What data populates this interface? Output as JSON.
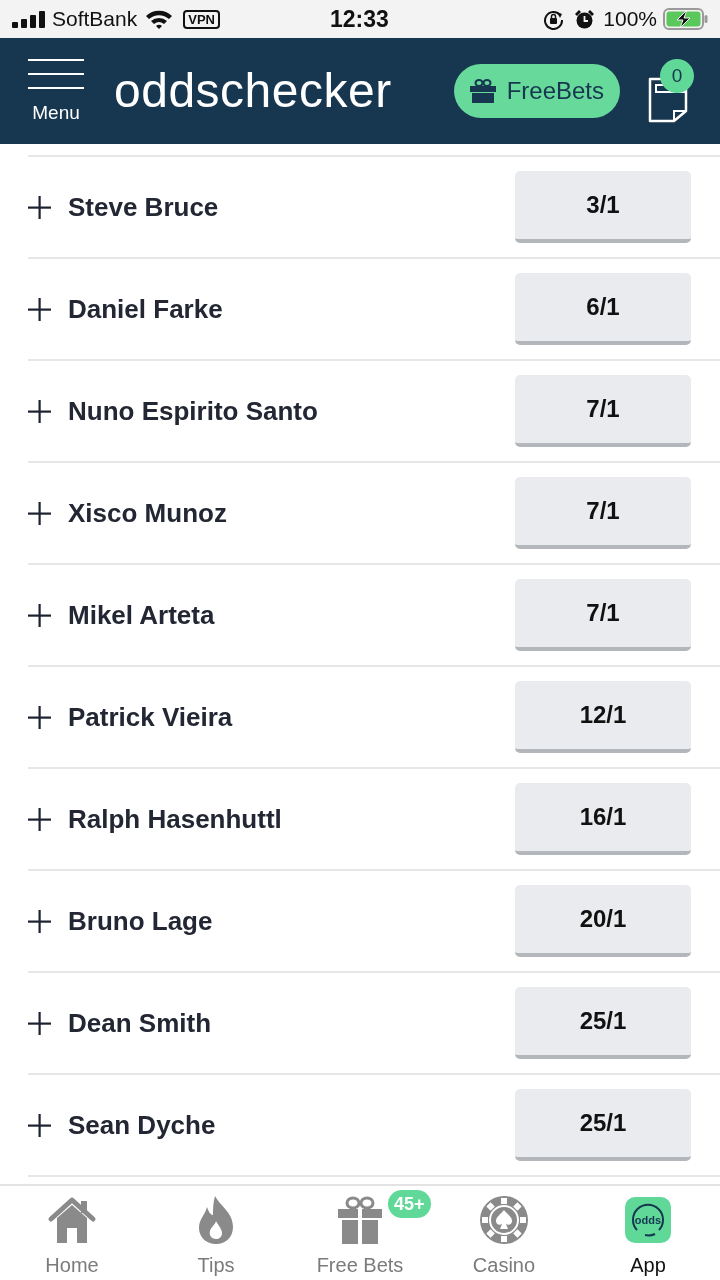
{
  "status_bar": {
    "carrier": "SoftBank",
    "vpn": "VPN",
    "time": "12:33",
    "battery": "100%"
  },
  "header": {
    "menu_label": "Menu",
    "logo": "oddschecker",
    "free_bets_button": "FreeBets",
    "bet_slip_count": "0"
  },
  "selections": [
    {
      "name": "Steve Bruce",
      "odds": "3/1"
    },
    {
      "name": "Daniel Farke",
      "odds": "6/1"
    },
    {
      "name": "Nuno Espirito Santo",
      "odds": "7/1"
    },
    {
      "name": "Xisco Munoz",
      "odds": "7/1"
    },
    {
      "name": "Mikel Arteta",
      "odds": "7/1"
    },
    {
      "name": "Patrick Vieira",
      "odds": "12/1"
    },
    {
      "name": "Ralph Hasenhuttl",
      "odds": "16/1"
    },
    {
      "name": "Bruno Lage",
      "odds": "20/1"
    },
    {
      "name": "Dean Smith",
      "odds": "25/1"
    },
    {
      "name": "Sean Dyche",
      "odds": "25/1"
    }
  ],
  "bottom_nav": [
    {
      "label": "Home",
      "selected": false
    },
    {
      "label": "Tips",
      "selected": false
    },
    {
      "label": "Free Bets",
      "badge": "45+",
      "selected": false
    },
    {
      "label": "Casino",
      "selected": false
    },
    {
      "label": "App",
      "logo_text": "odds",
      "selected": true
    }
  ]
}
